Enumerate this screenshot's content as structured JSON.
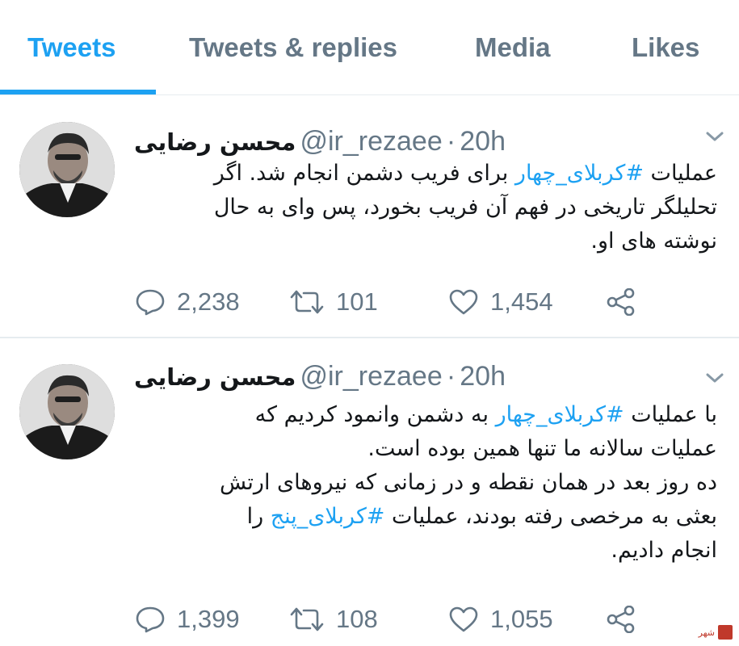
{
  "tabs": [
    {
      "label": "Tweets",
      "active": true
    },
    {
      "label": "Tweets & replies",
      "active": false
    },
    {
      "label": "Media",
      "active": false
    },
    {
      "label": "Likes",
      "active": false
    }
  ],
  "colors": {
    "accent": "#1da1f2",
    "muted": "#657786",
    "text": "#14171a",
    "divider": "#e6ecf0"
  },
  "tweets": [
    {
      "name": "محسن رضایی",
      "handle": "@ir_rezaee",
      "dot": "·",
      "time": "20h",
      "body": {
        "l1a": "عملیات ",
        "l1tag": "#کربلای_چهار",
        "l1b": " برای فریب دشمن انجام شد. اگر",
        "l2": "تحلیلگر تاریخی  در فهم آن فریب بخورد، پس وای به حال",
        "l3": "نوشته های او."
      },
      "stats": {
        "replies": "2,238",
        "retweets": "101",
        "likes": "1,454"
      }
    },
    {
      "name": "محسن رضایی",
      "handle": "@ir_rezaee",
      "dot": "·",
      "time": "20h",
      "body": {
        "l1a": "با عملیات ",
        "l1tag": "#کربلای_چهار",
        "l1b": " به دشمن وانمود کردیم که",
        "l2": "عملیات سالانه ما تنها همین بوده است.",
        "l3": "ده روز بعد در همان نقطه و در زمانی که نیروهای ارتش",
        "l4a": "بعثی به مرخصی رفته بودند، عملیات ",
        "l4tag": "#کربلای_پنج",
        "l4b": " را",
        "l5": "انجام دادیم."
      },
      "stats": {
        "replies": "1,399",
        "retweets": "108",
        "likes": "1,055"
      }
    }
  ],
  "icons": [
    "reply-icon",
    "retweet-icon",
    "like-icon",
    "share-icon",
    "chevron-down-icon"
  ],
  "watermark": {
    "text": "شهر"
  }
}
